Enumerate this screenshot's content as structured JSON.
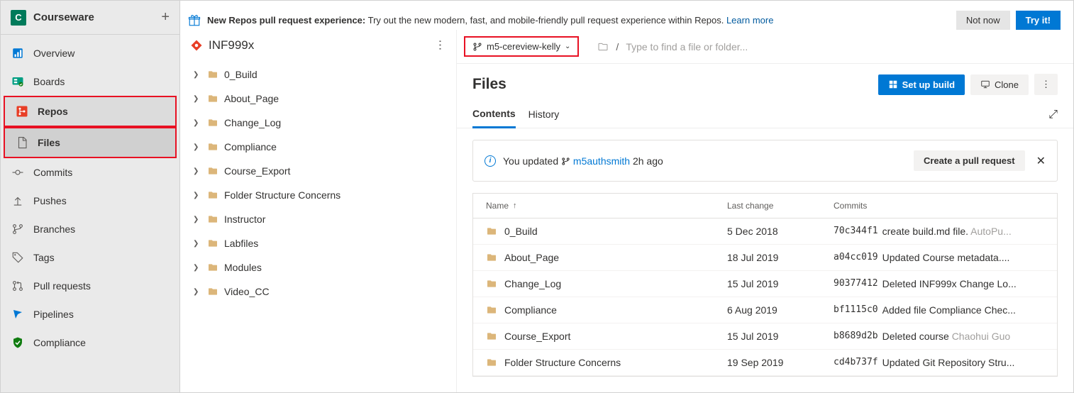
{
  "project": {
    "avatar_letter": "C",
    "name": "Courseware"
  },
  "sidebar": {
    "items": [
      {
        "label": "Overview"
      },
      {
        "label": "Boards"
      },
      {
        "label": "Repos"
      },
      {
        "label": "Files"
      },
      {
        "label": "Commits"
      },
      {
        "label": "Pushes"
      },
      {
        "label": "Branches"
      },
      {
        "label": "Tags"
      },
      {
        "label": "Pull requests"
      },
      {
        "label": "Pipelines"
      },
      {
        "label": "Compliance"
      }
    ]
  },
  "banner": {
    "title": "New Repos pull request experience:",
    "text": " Try out the new modern, fast, and mobile-friendly pull request experience within Repos. ",
    "link": "Learn more",
    "not_now": "Not now",
    "try_it": "Try it!"
  },
  "repo": {
    "name": "INF999x"
  },
  "tree": [
    {
      "name": "0_Build"
    },
    {
      "name": "About_Page"
    },
    {
      "name": "Change_Log"
    },
    {
      "name": "Compliance"
    },
    {
      "name": "Course_Export"
    },
    {
      "name": "Folder Structure Concerns"
    },
    {
      "name": "Instructor"
    },
    {
      "name": "Labfiles"
    },
    {
      "name": "Modules"
    },
    {
      "name": "Video_CC"
    }
  ],
  "branch": {
    "name": "m5-cereview-kelly"
  },
  "breadcrumb": {
    "placeholder": "Type to find a file or folder..."
  },
  "page": {
    "title": "Files"
  },
  "actions": {
    "setup_build": "Set up build",
    "clone": "Clone"
  },
  "tabs": {
    "contents": "Contents",
    "history": "History"
  },
  "notice": {
    "prefix": "You updated ",
    "branch": "m5authsmith",
    "when": " 2h ago",
    "cta": "Create a pull request"
  },
  "columns": {
    "name": "Name",
    "last_change": "Last change",
    "commits": "Commits"
  },
  "files": [
    {
      "name": "0_Build",
      "date": "5 Dec 2018",
      "hash": "70c344f1",
      "msg": "create build.md file. ",
      "author": "AutoPu..."
    },
    {
      "name": "About_Page",
      "date": "18 Jul 2019",
      "hash": "a04cc019",
      "msg": "Updated Course metadata....",
      "author": ""
    },
    {
      "name": "Change_Log",
      "date": "15 Jul 2019",
      "hash": "90377412",
      "msg": "Deleted INF999x Change Lo...",
      "author": ""
    },
    {
      "name": "Compliance",
      "date": "6 Aug 2019",
      "hash": "bf1115c0",
      "msg": "Added file Compliance Chec...",
      "author": ""
    },
    {
      "name": "Course_Export",
      "date": "15 Jul 2019",
      "hash": "b8689d2b",
      "msg": "Deleted course ",
      "author": "Chaohui Guo"
    },
    {
      "name": "Folder Structure Concerns",
      "date": "19 Sep 2019",
      "hash": "cd4b737f",
      "msg": "Updated Git Repository Stru...",
      "author": ""
    }
  ]
}
